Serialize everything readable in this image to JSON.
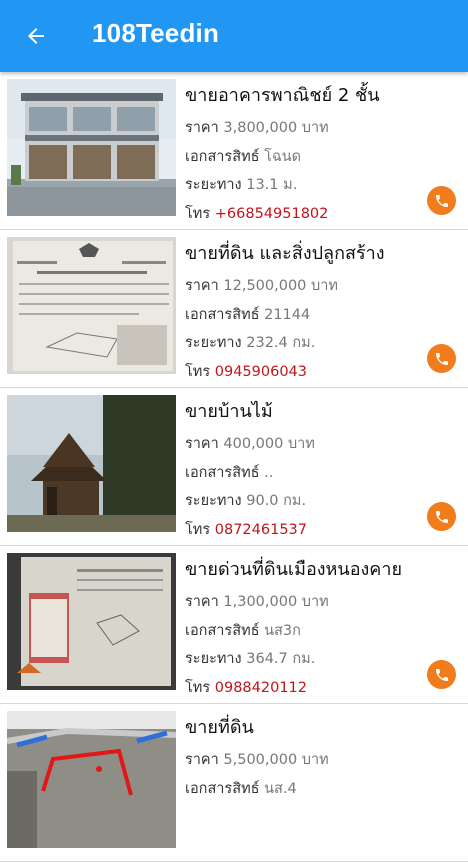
{
  "appbar": {
    "title": "108Teedin",
    "back_icon": "arrow-left-icon",
    "color": "#2196f3"
  },
  "labels": {
    "price": "ราคา",
    "doc": "เอกสารสิทธ์",
    "distance": "ระยะทาง",
    "phone": "โทร"
  },
  "colors": {
    "phone_text": "#c2141b",
    "call_button": "#f07c1b"
  },
  "listings": [
    {
      "name": "ขายอาคารพาณิชย์ 2 ชั้น",
      "price": "3,800,000 บาท",
      "doc": "โฉนด",
      "distance": "13.1 ม.",
      "phone": "+66854951802"
    },
    {
      "name": "ขายที่ดิน และสิ่งปลูกสร้าง",
      "price": "12,500,000 บาท",
      "doc": "21144",
      "distance": "232.4 กม.",
      "phone": "0945906043"
    },
    {
      "name": "ขายบ้านไม้",
      "price": "400,000 บาท",
      "doc": "..",
      "distance": "90.0 กม.",
      "phone": "0872461537"
    },
    {
      "name": "ขายด่วนที่ดินเมืองหนองคาย",
      "price": "1,300,000 บาท",
      "doc": "นส3ก",
      "distance": "364.7 กม.",
      "phone": "0988420112"
    },
    {
      "name": "ขายที่ดิน",
      "price": "5,500,000 บาท",
      "doc": "นส.4",
      "distance": "",
      "phone": ""
    }
  ]
}
